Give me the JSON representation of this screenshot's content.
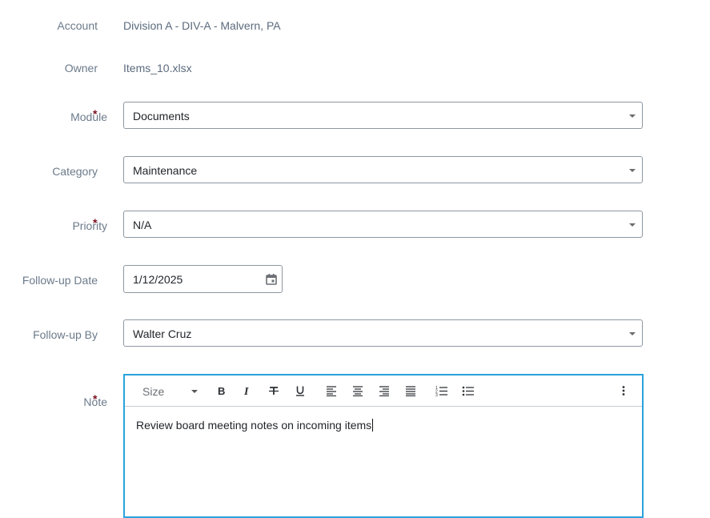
{
  "account": {
    "label": "Account",
    "value": "Division A - DIV-A - Malvern, PA"
  },
  "owner": {
    "label": "Owner",
    "value": "Items_10.xlsx"
  },
  "module": {
    "label": "Module",
    "required": "*",
    "value": "Documents"
  },
  "category": {
    "label": "Category",
    "value": "Maintenance"
  },
  "priority": {
    "label": "Priority",
    "required": "*",
    "value": "N/A"
  },
  "followup_date": {
    "label": "Follow-up Date",
    "value": "1/12/2025",
    "icon": "calendar-icon"
  },
  "followup_by": {
    "label": "Follow-up By",
    "value": "Walter Cruz"
  },
  "note": {
    "label": "Note",
    "required": "*",
    "toolbar": {
      "size_label": "Size",
      "buttons": [
        "bold-icon",
        "italic-icon",
        "strikethrough-icon",
        "underline-icon",
        "align-left-icon",
        "align-center-icon",
        "align-right-icon",
        "align-justify-icon",
        "ordered-list-icon",
        "bullet-list-icon",
        "more-vertical-icon"
      ]
    },
    "content": "Review board meeting notes on incoming items"
  },
  "colors": {
    "accent_border": "#29a3dc",
    "required": "#7a1020",
    "label": "#6b7a8a"
  }
}
